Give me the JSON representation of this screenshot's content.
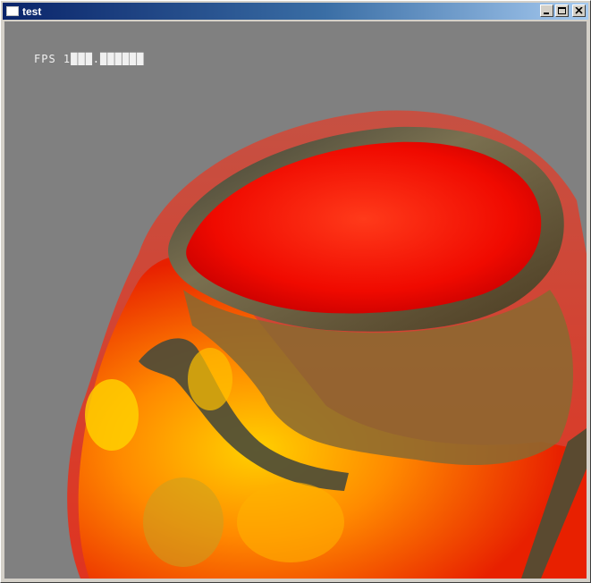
{
  "window": {
    "title": "test",
    "controls": {
      "minimize": "minimize-icon",
      "maximize": "maximize-icon",
      "close": "close-icon"
    }
  },
  "viewport": {
    "fps_label": "FPS 1███.██████",
    "background_color": "#808080",
    "content": "volume-rendered-skull"
  },
  "colors": {
    "titlebar_start": "#0a246a",
    "titlebar_end": "#a6caf0",
    "skin": "#ff3010",
    "bone": "#6a5a3a"
  }
}
